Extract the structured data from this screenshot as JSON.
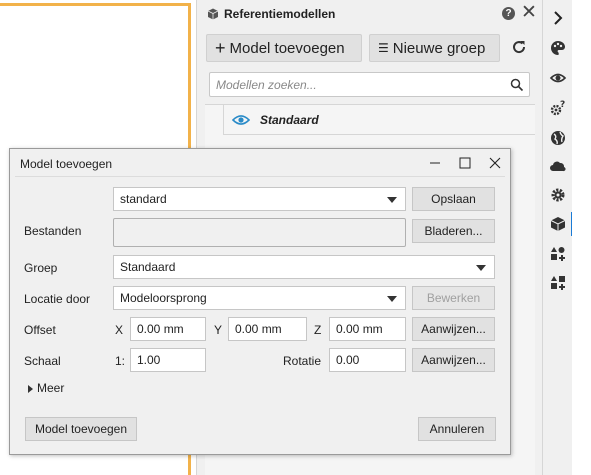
{
  "panel": {
    "title": "Referentiemodellen",
    "help_glyph": "?",
    "close_glyph": "✕",
    "add_model_label": "Model toevoegen",
    "new_group_label": "Nieuwe groep",
    "search_placeholder": "Modellen zoeken...",
    "tree": [
      {
        "label": "Standaard",
        "visible": true
      }
    ]
  },
  "toolbar": {
    "expand_glyph": "›",
    "tools": [
      "palette-icon",
      "eye-settings-icon",
      "help-settings-icon",
      "globe-icon",
      "cloud-icon",
      "gear-icon",
      "cube-icon",
      "shapes-add-icon",
      "shapes-add-icon"
    ],
    "active_tool": "cube-icon"
  },
  "dialog": {
    "title": "Model toevoegen",
    "source_value": "standard",
    "save_label": "Opslaan",
    "files_label": "Bestanden",
    "files_value": "",
    "browse_label": "Bladeren...",
    "group_label": "Groep",
    "group_value": "Standaard",
    "location_label": "Locatie door",
    "location_value": "Modeloorsprong",
    "edit_label": "Bewerken",
    "offset_label": "Offset",
    "offset_x_prefix": "X",
    "offset_x": "0.00 mm",
    "offset_y_prefix": "Y",
    "offset_y": "0.00 mm",
    "offset_z_prefix": "Z",
    "offset_z": "0.00 mm",
    "pick_label": "Aanwijzen...",
    "scale_label": "Schaal",
    "scale_prefix": "1:",
    "scale_value": "1.00",
    "rotation_label": "Rotatie",
    "rotation_value": "0.00",
    "pick_label_2": "Aanwijzen...",
    "more_label": "Meer",
    "add_button_label": "Model toevoegen",
    "cancel_label": "Annuleren"
  },
  "colors": {
    "accent": "#1a7bd6",
    "canvas_frame": "#f2b24a",
    "eye": "#2a8bc8"
  }
}
